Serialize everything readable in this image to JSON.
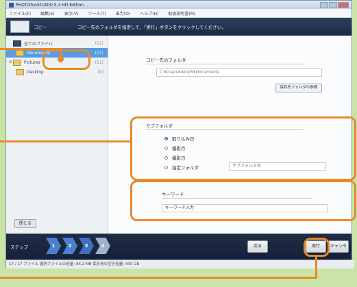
{
  "window": {
    "title": "PHOTOfunSTUDIO 5.3 HD Edition"
  },
  "menu": [
    "ファイル(F)",
    "編集(E)",
    "表示(V)",
    "ツール(T)",
    "出力(O)",
    "ヘルプ(H)",
    "取扱説明書(M)"
  ],
  "header": {
    "step_title": "コピー",
    "instruction": "コピー先のフォルダを指定して、「実行」ボタンをクリックしてください。"
  },
  "sidebar": {
    "items": [
      {
        "label": "全てのファイル",
        "count": "(11)"
      },
      {
        "label": "Documents",
        "count": "(11)"
      },
      {
        "label": "Pictures",
        "count": "(11)"
      },
      {
        "label": "Desktop",
        "count": "(0)"
      }
    ],
    "close_label": "閉じる"
  },
  "copy_dest": {
    "label": "コピー先のフォルダ",
    "path": "C:¥Users¥win05¥Documents",
    "browse_label": "保存先フォルダの参照"
  },
  "subfolder": {
    "label": "サブフォルダ",
    "options": [
      "取り込み日",
      "撮影月",
      "撮影日",
      "指定フォルダ"
    ],
    "selected": "取り込み日",
    "name_placeholder": "サブフォルダ名"
  },
  "keyword": {
    "label": "キーワード",
    "value": "キーワード入力"
  },
  "footer": {
    "step_label": "ステップ",
    "steps": [
      "1",
      "2",
      "3",
      "4"
    ],
    "back_label": "戻る",
    "run_label": "実行",
    "cancel_label": "キャンセル"
  },
  "status": {
    "text": "17 / 17 ファイル  選択ファイルの容量: 86.2 MB  保存先の空き容量: 400 GB"
  },
  "colors": {
    "highlight": "#e8892a",
    "background": "#c9e4a6",
    "selected": "#5b9be0"
  }
}
